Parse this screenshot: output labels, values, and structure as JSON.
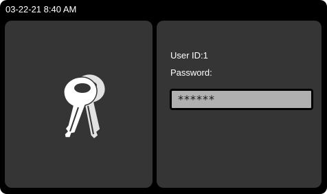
{
  "status_bar": {
    "datetime": "03-22-21 8:40 AM"
  },
  "login_panel": {
    "user_id_text": "User ID:1",
    "password_label": "Password:",
    "password_field_value": "******"
  },
  "icons": {
    "keys": "keys-icon"
  },
  "colors": {
    "background": "#000000",
    "panel": "#353535",
    "field_fill": "#b0b0b0",
    "text": "#ffffff"
  }
}
